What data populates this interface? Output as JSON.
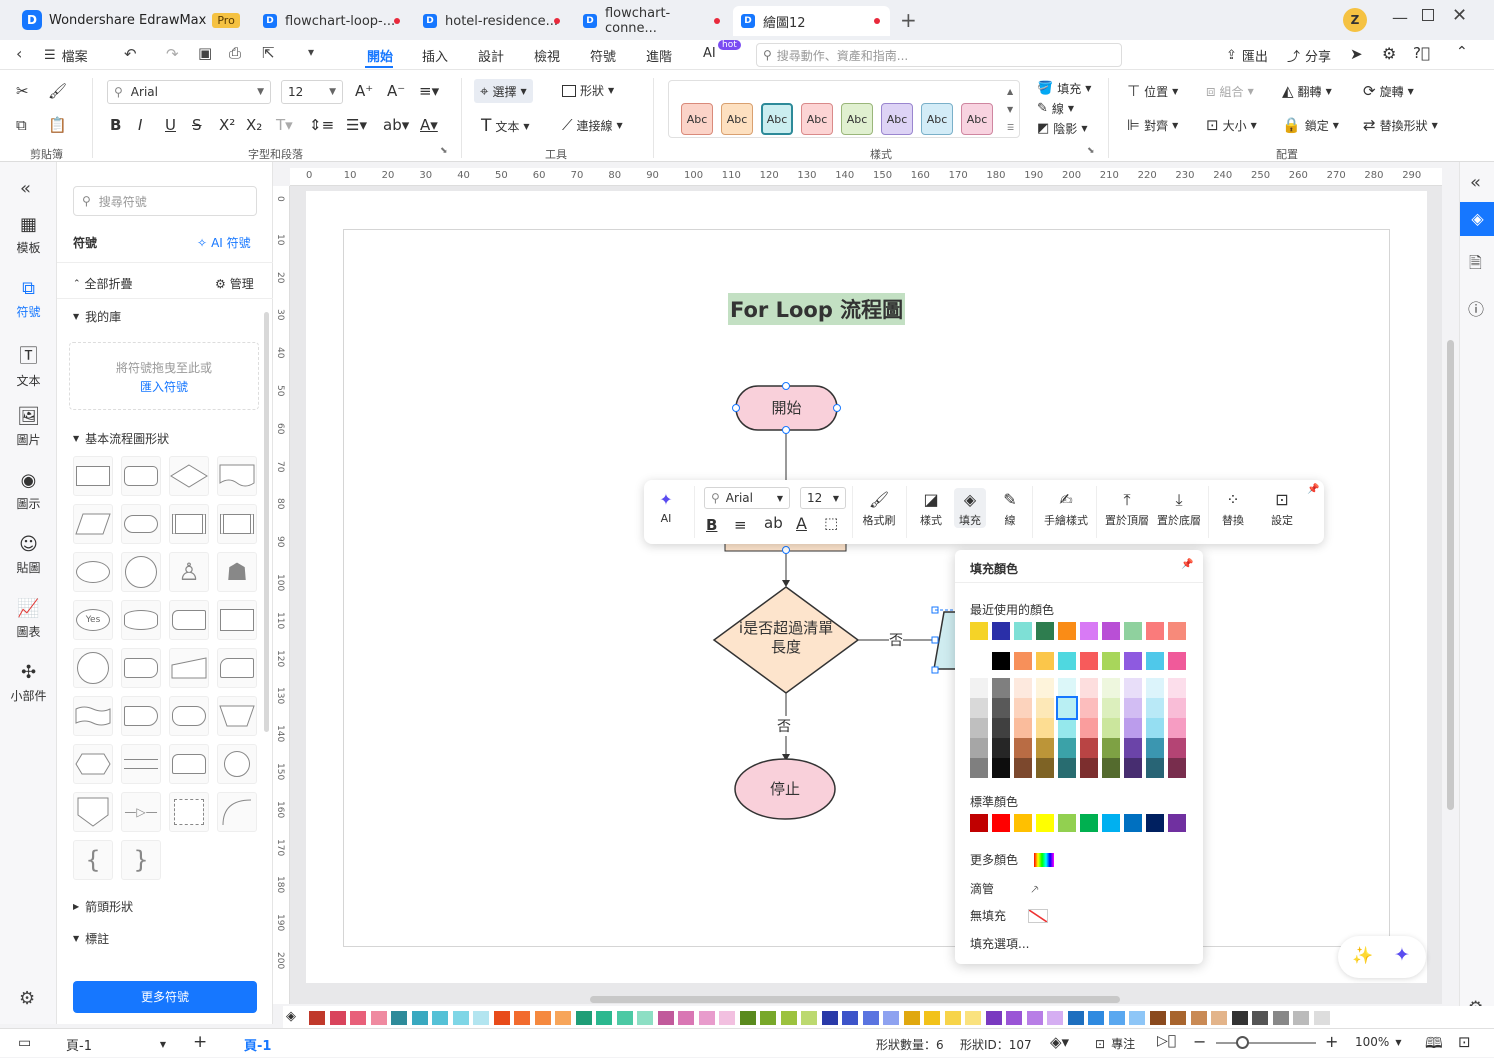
{
  "titlebar": {
    "app_name": "Wondershare EdrawMax",
    "pro_badge": "Pro",
    "tabs": [
      "flowchart-loop-...",
      "hotel-residence...",
      "flowchart-conne...",
      "繪圖12"
    ],
    "user_initial": "Z"
  },
  "menubar": {
    "file": "檔案",
    "items": [
      "開始",
      "插入",
      "設計",
      "檢視",
      "符號",
      "進階",
      "AI"
    ],
    "ai_badge": "hot",
    "search_placeholder": "搜尋動作、資產和指南...",
    "export": "匯出",
    "share": "分享"
  },
  "ribbon": {
    "font_name": "Arial",
    "font_size": "12",
    "select": "選擇",
    "shape": "形狀",
    "text": "文本",
    "connector": "連接線",
    "style_sample": "Abc",
    "fill": "填充",
    "line": "線",
    "shadow": "陰影",
    "position": "位置",
    "group": "組合",
    "flip": "翻轉",
    "rotate": "旋轉",
    "align": "對齊",
    "size": "大小",
    "lock": "鎖定",
    "replace_shape": "替換形狀",
    "groups": {
      "clipboard": "剪貼簿",
      "font": "字型和段落",
      "tools": "工具",
      "styles": "樣式",
      "arrange": "配置"
    }
  },
  "leftnav": {
    "items": [
      "模板",
      "符號",
      "文本",
      "圖片",
      "圖示",
      "貼圖",
      "圖表",
      "小部件"
    ]
  },
  "panel": {
    "search_placeholder": "搜尋符號",
    "title": "符號",
    "ai_symbols": "AI 符號",
    "collapse_all": "全部折疊",
    "manage": "管理",
    "my_library": "我的庫",
    "drop_hint": "將符號拖曳至此或",
    "import_link": "匯入符號",
    "basic_flowchart": "基本流程圖形狀",
    "arrow_shapes": "箭頭形狀",
    "annotation": "標註",
    "more_symbols": "更多符號",
    "yes_label": "Yes"
  },
  "ruler": {
    "top": [
      "0",
      "10",
      "20",
      "30",
      "40",
      "50",
      "60",
      "70",
      "80",
      "90",
      "100",
      "110",
      "120",
      "130",
      "140",
      "150",
      "160",
      "170",
      "180",
      "190",
      "200",
      "210",
      "220",
      "230",
      "240",
      "250",
      "260",
      "270",
      "280",
      "290"
    ],
    "left": [
      "0",
      "10",
      "20",
      "30",
      "40",
      "50",
      "60",
      "70",
      "80",
      "90",
      "100",
      "110",
      "120",
      "130",
      "140",
      "150",
      "160",
      "170",
      "180",
      "190",
      "200"
    ]
  },
  "diagram": {
    "title": "For Loop 流程圖",
    "start": "開始",
    "decision": "i是否超過清單長度",
    "no_right": "否",
    "no_down": "否",
    "stop": "停止"
  },
  "floatbar": {
    "ai": "AI",
    "font": "Arial",
    "size": "12",
    "format_painter": "格式刷",
    "style": "樣式",
    "fill": "填充",
    "line": "線",
    "sketch_style": "手繪樣式",
    "bring_front": "置於頂層",
    "send_back": "置於底層",
    "replace": "替換",
    "settings": "設定"
  },
  "colorpanel": {
    "title": "填充顏色",
    "recent": "最近使用的顏色",
    "standard": "標準顏色",
    "more_colors": "更多顏色",
    "eyedropper": "滴管",
    "no_fill": "無填充",
    "fill_options": "填充選項...",
    "recent_colors": [
      "#f5d327",
      "#2a2fa8",
      "#7ee0d6",
      "#2e7d4f",
      "#fa8c16",
      "#d87af5",
      "#b94fd6",
      "#8fd19e",
      "#fa7b7b",
      "#f78a7a"
    ],
    "base_colors": [
      "#ffffff",
      "#000000",
      "#f7905a",
      "#fbc64a",
      "#4fd8e0",
      "#f75b5b",
      "#a8d65b",
      "#8e5ae0",
      "#4fc8ea",
      "#f05a9a"
    ],
    "standard_colors": [
      "#c00000",
      "#ff0000",
      "#ffc000",
      "#ffff00",
      "#92d050",
      "#00b050",
      "#00b0f0",
      "#0070c0",
      "#002060",
      "#7030a0"
    ]
  },
  "statusbar": {
    "page_name": "頁-1",
    "page_tab": "頁-1",
    "shape_count": "形狀數量：6",
    "shape_id": "形狀ID：107",
    "focus": "專注",
    "zoom": "100%"
  },
  "palette_colors": [
    "#c0392b",
    "#d9445c",
    "#e8607a",
    "#ef8aa0",
    "#2e8b9a",
    "#3aa9c0",
    "#55c1d6",
    "#7fd6e6",
    "#b3e5f0",
    "#e84b1a",
    "#f26b2e",
    "#f5893f",
    "#f7a55a",
    "#1f9e77",
    "#2cb88f",
    "#4cc9a4",
    "#8ddfc4",
    "#c15a9b",
    "#d977b4",
    "#e89ccc",
    "#f2c0e0",
    "#5a8a1e",
    "#78a82a",
    "#9cc23f",
    "#bcd970",
    "#2a3aa8",
    "#3d54c9",
    "#5a74e0",
    "#8ea2f0",
    "#e0a80f",
    "#f2c21a",
    "#f7d44a",
    "#fae27e",
    "#7a3ac0",
    "#9a55d6",
    "#b87ee6",
    "#d5aef2",
    "#1e6fbf",
    "#2f8ae0",
    "#5aa8f0",
    "#8ec6f7",
    "#8a4a1e",
    "#a8652e",
    "#c98a55",
    "#e3b48a",
    "#333333",
    "#555555",
    "#888888",
    "#bbbbbb",
    "#dddddd"
  ]
}
